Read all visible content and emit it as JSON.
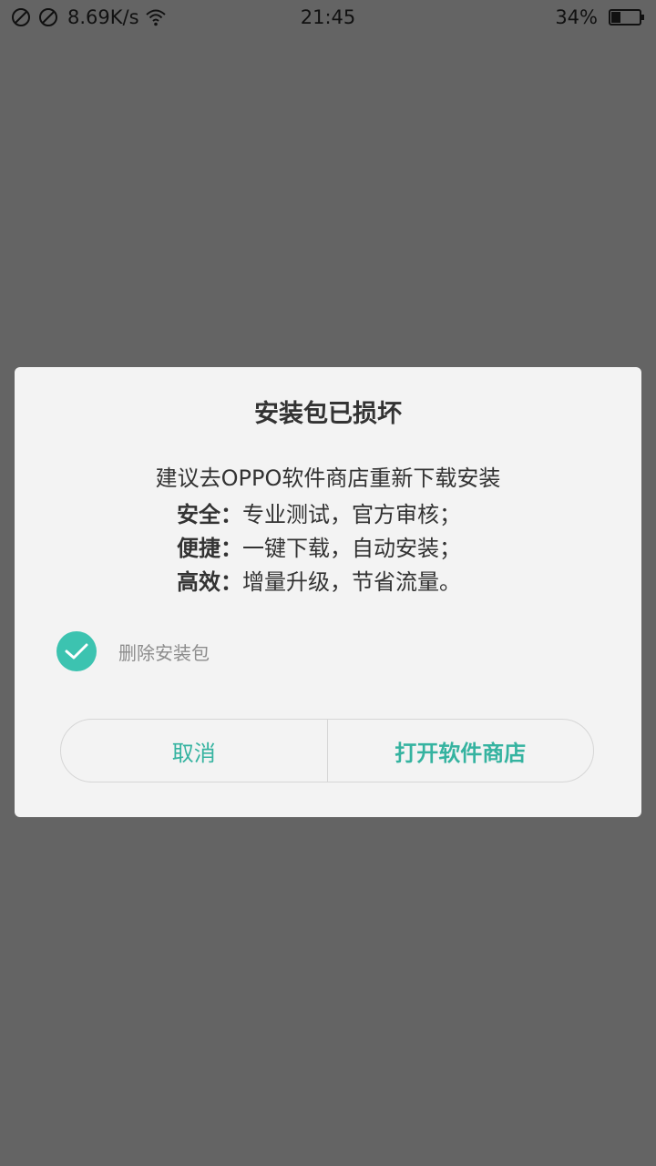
{
  "status_bar": {
    "net_speed": "8.69K/s",
    "time": "21:45",
    "battery_pct": "34%",
    "battery_level": 0.34,
    "icons": [
      "no-sim-icon",
      "blocked-icon",
      "wifi-icon",
      "battery-icon"
    ]
  },
  "dialog": {
    "title": "安装包已损坏",
    "message": "建议去OPPO软件商店重新下载安装",
    "features": [
      {
        "key": "安全：",
        "value": "专业测试，官方审核；"
      },
      {
        "key": "便捷：",
        "value": "一键下载，自动安装；"
      },
      {
        "key": "高效：",
        "value": "增量升级，节省流量。"
      }
    ],
    "checkbox": {
      "label": "删除安装包",
      "checked": true
    },
    "buttons": {
      "cancel": "取消",
      "open_store": "打开软件商店"
    }
  },
  "colors": {
    "overlay": "#646464",
    "dialog_bg": "#f3f3f3",
    "accent": "#3cc3b0",
    "button_text": "#35b3a0"
  }
}
